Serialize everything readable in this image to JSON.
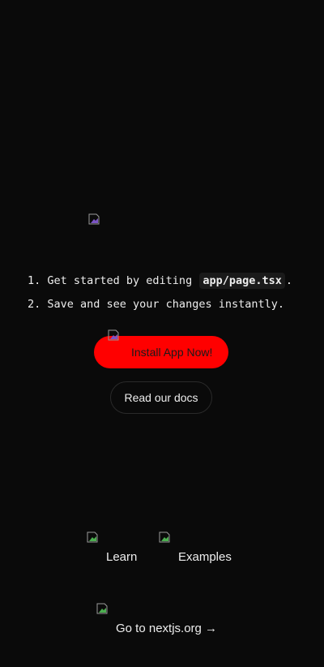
{
  "steps": {
    "step1_prefix": "1. Get started by editing",
    "step1_code": "app/page.tsx",
    "step1_suffix": ".",
    "step2": "2. Save and see your changes instantly."
  },
  "buttons": {
    "install_label": "Install App Now!",
    "docs_label": "Read our docs"
  },
  "footer": {
    "learn_label": "Learn",
    "examples_label": "Examples",
    "nextjs_label": "Go to nextjs.org →"
  },
  "colors": {
    "background": "#0a0a0a",
    "text": "#ededed",
    "primary_button": "#ff0000"
  },
  "icons": {
    "logo": "broken-image-icon",
    "install": "broken-image-icon",
    "learn": "broken-image-icon",
    "examples": "broken-image-icon",
    "globe": "broken-image-icon"
  }
}
